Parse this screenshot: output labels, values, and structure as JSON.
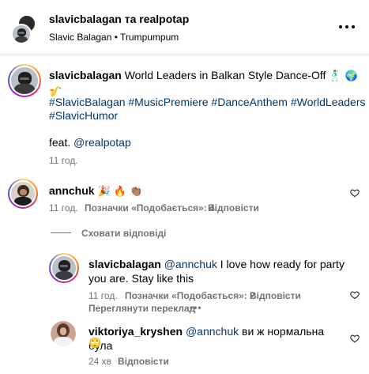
{
  "header": {
    "title": "slavicbalagan та realpotap",
    "subtitle": "Slavic Balagan • Trumpumpum"
  },
  "post": {
    "username": "slavicbalagan",
    "caption": "World Leaders in Balkan Style Dance-Off",
    "caption_emojis": "🕺 🌍 🎷",
    "hashtags_line1": "#SlavicBalagan #MusicPremiere #DanceAnthem #WorldLeaders",
    "hashtags_line2": "#SlavicHumor",
    "feat_prefix": "feat.",
    "feat_mention": "@realpotap",
    "time": "11 год."
  },
  "comment1": {
    "username": "annchuk",
    "emojis": "🎉 🔥 👏🏽",
    "time": "11 год.",
    "likes": "Позначки «Подобається»: 4",
    "reply": "Відповісти"
  },
  "hide_replies": "Сховати відповіді",
  "reply1": {
    "username": "slavicbalagan",
    "mention": "@annchuk",
    "text_line1": "I love how ready for party",
    "text_line2": "you are. Stay like this",
    "time": "11 год.",
    "likes": "Позначки «Подобається»: 2",
    "reply": "Відповісти",
    "translate": "Переглянути переклад",
    "more": "•••"
  },
  "reply2": {
    "username": "viktoriya_kryshen",
    "mention": "@annchuk",
    "text": "ви ж нормальна була",
    "emoji": "🙄",
    "time": "24 хв",
    "reply": "Відповісти"
  }
}
